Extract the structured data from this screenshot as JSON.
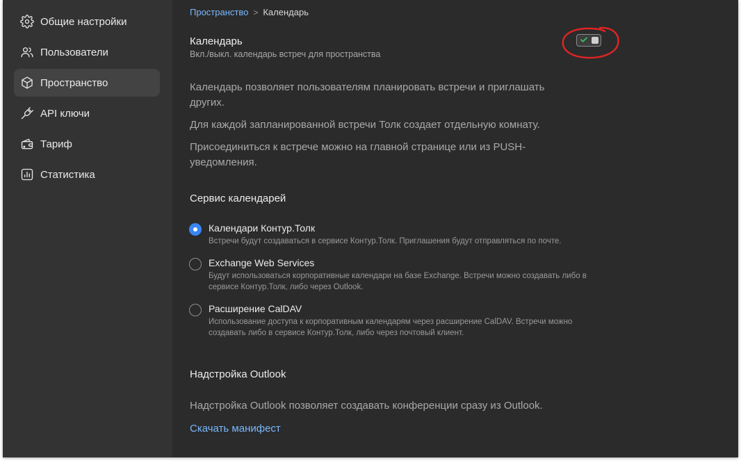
{
  "sidebar": {
    "items": [
      {
        "label": "Общие настройки",
        "icon": "gear-icon",
        "active": false
      },
      {
        "label": "Пользователи",
        "icon": "users-icon",
        "active": false
      },
      {
        "label": "Пространство",
        "icon": "cube-icon",
        "active": true
      },
      {
        "label": "API ключи",
        "icon": "plug-icon",
        "active": false
      },
      {
        "label": "Тариф",
        "icon": "wallet-icon",
        "active": false
      },
      {
        "label": "Статистика",
        "icon": "chart-icon",
        "active": false
      }
    ]
  },
  "breadcrumb": {
    "parent": "Пространство",
    "separator": ">",
    "current": "Календарь"
  },
  "calendar": {
    "title": "Календарь",
    "subtitle": "Вкл./выкл. календарь встреч для пространства",
    "enabled": true,
    "paragraphs": [
      "Календарь позволяет пользователям планировать встречи и приглашать других.",
      "Для каждой запланированной встречи Толк создает отдельную комнату.",
      "Присоединиться к встрече можно на главной странице или из PUSH-уведомления."
    ]
  },
  "service": {
    "title": "Сервис календарей",
    "options": [
      {
        "label": "Календари Контур.Толк",
        "description": "Встречи будут создаваться в сервисе Контур.Толк. Приглашения будут отправляться по почте.",
        "selected": true
      },
      {
        "label": "Exchange Web Services",
        "description": "Будут использоваться корпоративные календари на базе Exchange. Встречи можно создавать либо в сервисе Контур.Толк, либо через Outlook.",
        "selected": false
      },
      {
        "label": "Расширение CalDAV",
        "description": "Использование доступа к корпоративным календарям через расширение CalDAV. Встречи можно создавать либо в сервисе Контур.Толк, либо через почтовый клиент.",
        "selected": false
      }
    ]
  },
  "outlook": {
    "title": "Надстройка Outlook",
    "text": "Надстройка Outlook позволяет создавать конференции сразу из Outlook.",
    "link": "Скачать манифест"
  },
  "colors": {
    "background": "#2b2b2b",
    "sidebar": "#333333",
    "accent_link": "#79b8ff",
    "radio_selected": "#3a86f2",
    "annotation_circle": "#e02424",
    "toggle_check": "#3fbf5a"
  }
}
